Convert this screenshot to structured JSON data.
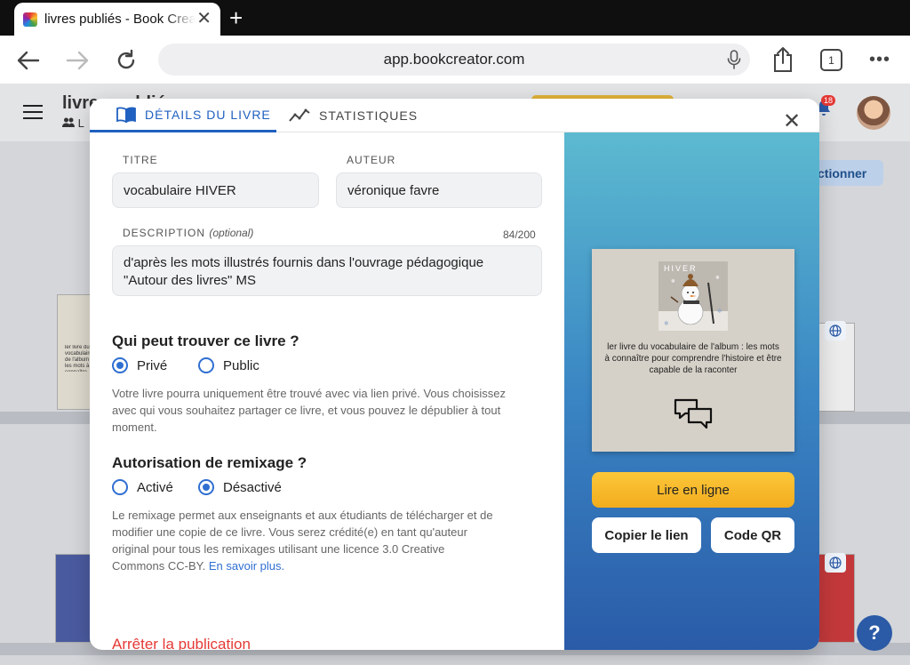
{
  "browser": {
    "tab_title": "livres publiés - Book Creator",
    "url": "app.bookcreator.com",
    "tab_count": "1"
  },
  "app": {
    "title": "livres publiés",
    "subtitle": "L",
    "select_button": "ctionner",
    "notification_count": "18",
    "help": "?",
    "bg_book_text": "ler livre du vocabulaire de l'album : les mots à connaître pour comprendre"
  },
  "modal": {
    "tabs": [
      "DÉTAILS DU LIVRE",
      "STATISTIQUES"
    ],
    "title_label": "TITRE",
    "title_value": "vocabulaire HIVER",
    "author_label": "AUTEUR",
    "author_value": "véronique favre",
    "description_label": "DESCRIPTION",
    "description_optional": "(optional)",
    "description_counter": "84/200",
    "description_value": "d'après les mots illustrés fournis dans l'ouvrage pédagogique \"Autour des livres\" MS",
    "visibility": {
      "title": "Qui peut trouver ce livre ?",
      "options": [
        "Privé",
        "Public"
      ],
      "selected": "Privé",
      "help": "Votre livre pourra uniquement être trouvé avec via lien privé. Vous choisissez avec qui vous souhaitez partager ce livre, et vous pouvez le dépublier à tout moment."
    },
    "remix": {
      "title": "Autorisation de remixage ?",
      "options": [
        "Activé",
        "Désactivé"
      ],
      "selected": "Désactivé",
      "help": "Le remixage permet aux enseignants et aux étudiants de télécharger et de modifier une copie de ce livre. Vous serez crédité(e) en tant qu'auteur original pour tous les remixages utilisant une licence 3.0 Creative Commons CC-BY.",
      "learn_more": "En savoir plus."
    },
    "stop_publishing": "Arrêter la publication",
    "cover": {
      "image_title": "HIVER",
      "text": "ler livre du vocabulaire de l'album : les mots à connaître pour comprendre l'histoire et être capable de la raconter"
    },
    "read_online": "Lire en ligne",
    "copy_link": "Copier le lien",
    "qr_code": "Code QR"
  },
  "colors": {
    "accent": "#2f6fd1",
    "danger": "#e53935",
    "read_button": "#f7b928"
  }
}
